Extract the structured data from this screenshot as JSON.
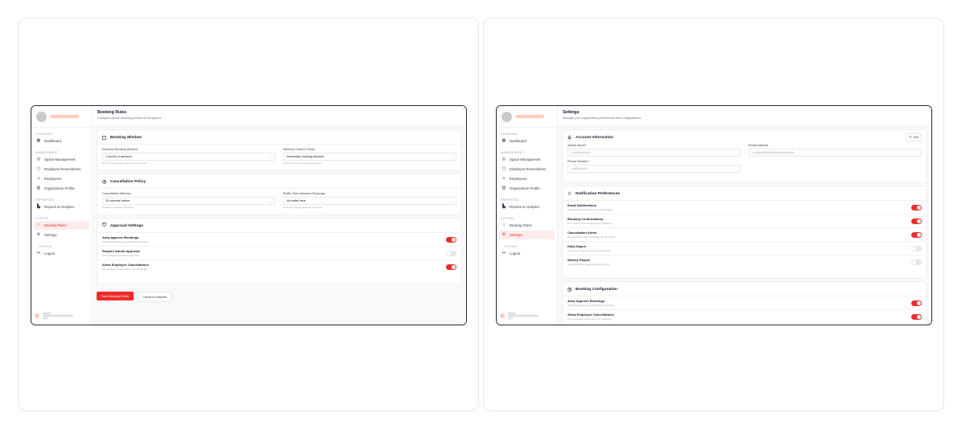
{
  "sidebar": {
    "sections": {
      "overview": "OVERVIEW",
      "management": "MANAGEMENT",
      "reporting": "REPORTING",
      "system": "SYSTEM",
      "system2": "SYSTEM"
    },
    "items": {
      "dashboard": "Dashboard",
      "space_management": "Space Management",
      "employee_reservations": "Employee Reservations",
      "employees": "Employees",
      "organization_profile": "Organization Profile",
      "reports_analytics": "Reports & Analytics",
      "booking_rules": "Booking Rules",
      "settings": "Settings",
      "logout": "Logout"
    }
  },
  "booking_rules": {
    "title": "Booking Rules",
    "subtitle": "Configure global booking policies for all spaces",
    "booking_window": {
      "title": "Booking Window",
      "advance_label": "Advance Booking Window",
      "advance_value": "1 month in advance",
      "advance_help": "How far in advance employees can book",
      "notice_label": "Minimum Notice Period",
      "notice_value": "Immediate booking allowed",
      "notice_help": "Minimum time before booking starts"
    },
    "cancellation": {
      "title": "Cancellation Policy",
      "window_label": "Cancellation Window",
      "window_value": "30 minutes before",
      "window_help": "Deadline to cancel a booking",
      "buffer_label": "Buffer Time Between Bookings",
      "buffer_value": "No buffer time",
      "buffer_help": "Time for cleaning between bookings"
    },
    "approval": {
      "title": "Approval Settings",
      "items": [
        {
          "title": "Auto-approve Bookings",
          "desc": "Automatically approve all booking requests",
          "on": true
        },
        {
          "title": "Require Admin Approval",
          "desc": "All bookings need admin approval",
          "on": false
        },
        {
          "title": "Allow Employee Cancellations",
          "desc": "Let employees cancel their own bookings",
          "on": true
        }
      ]
    },
    "save_label": "Save Booking Rules",
    "reset_label": "Reset to Defaults"
  },
  "settings": {
    "title": "Settings",
    "subtitle": "Manage your organization preferences and configurations",
    "account": {
      "title": "Account Information",
      "edit_label": "Edit",
      "admin_name_label": "Admin Name*",
      "email_label": "Email Address",
      "phone_label": "Phone Number*"
    },
    "notifications": {
      "title": "Notification Preferences",
      "items": [
        {
          "title": "Email Notifications",
          "desc": "Receive email alerts for important updates",
          "on": true
        },
        {
          "title": "Booking Confirmations",
          "desc": "Get notified when bookings are confirmed",
          "on": true
        },
        {
          "title": "Cancellation Alerts",
          "desc": "Receive alerts when bookings are cancelled",
          "on": true
        },
        {
          "title": "Daily Digest",
          "desc": "Summary of daily bookings and activities",
          "on": false
        },
        {
          "title": "Weekly Report",
          "desc": "Comprehensive weekly analytics report",
          "on": false
        }
      ]
    },
    "booking_config": {
      "title": "Booking Configuration",
      "items": [
        {
          "title": "Auto-Approve Bookings",
          "desc": "Automatically approve all booking requests",
          "on": true
        },
        {
          "title": "Allow Employee Cancellations",
          "desc": "Let employees cancel their own bookings",
          "on": true
        }
      ]
    }
  },
  "icons": {
    "dashboard": "grid-icon",
    "space": "map-pin-icon",
    "reservations": "calendar-icon",
    "employees": "users-icon",
    "organization": "building-icon",
    "reports": "bar-chart-icon",
    "booking_rules": "circle-icon",
    "settings": "gear-icon",
    "logout": "logout-icon"
  },
  "colors": {
    "accent": "#ef2b2b",
    "active_bg": "#fdecec"
  }
}
